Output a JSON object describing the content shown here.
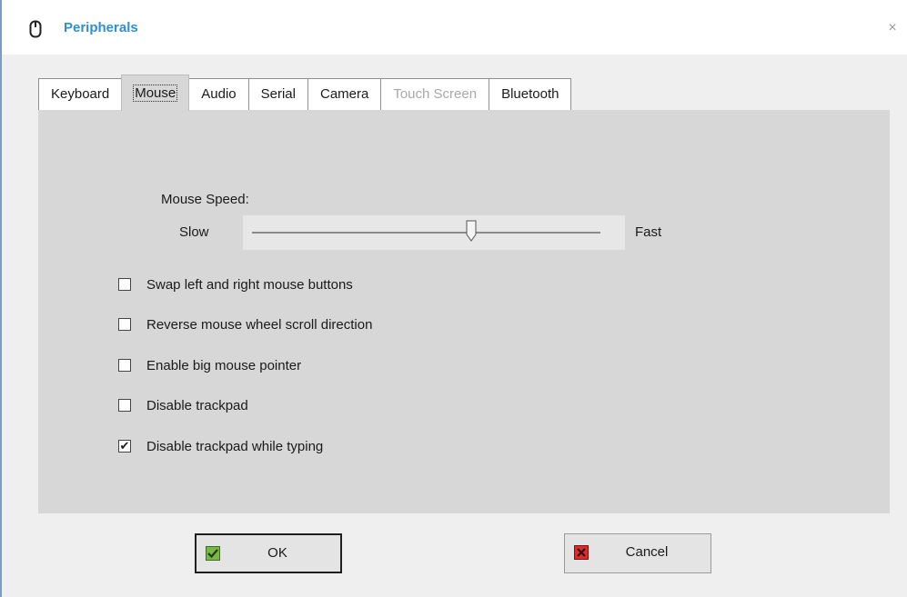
{
  "window": {
    "title": "Peripherals",
    "icon": "mouse-icon",
    "close_icon": "close-icon"
  },
  "tabs": [
    {
      "label": "Keyboard",
      "state": "normal"
    },
    {
      "label": "Mouse",
      "state": "active"
    },
    {
      "label": "Audio",
      "state": "normal"
    },
    {
      "label": "Serial",
      "state": "normal"
    },
    {
      "label": "Camera",
      "state": "normal"
    },
    {
      "label": "Touch Screen",
      "state": "disabled"
    },
    {
      "label": "Bluetooth",
      "state": "normal"
    }
  ],
  "mouse_speed": {
    "label": "Mouse Speed:",
    "min_label": "Slow",
    "max_label": "Fast",
    "value_fraction": 0.63
  },
  "options": [
    {
      "label": "Swap left and right mouse buttons",
      "checked": false
    },
    {
      "label": "Reverse mouse wheel scroll direction",
      "checked": false
    },
    {
      "label": "Enable big mouse pointer",
      "checked": false
    },
    {
      "label": "Disable trackpad",
      "checked": false
    },
    {
      "label": "Disable trackpad while typing",
      "checked": true
    }
  ],
  "buttons": {
    "ok": {
      "label": "OK",
      "icon": "check-icon"
    },
    "cancel": {
      "label": "Cancel",
      "icon": "x-icon"
    }
  },
  "colors": {
    "title": "#2d8fd5",
    "ok_icon": "#7ab648",
    "cancel_icon": "#d92c2c"
  }
}
